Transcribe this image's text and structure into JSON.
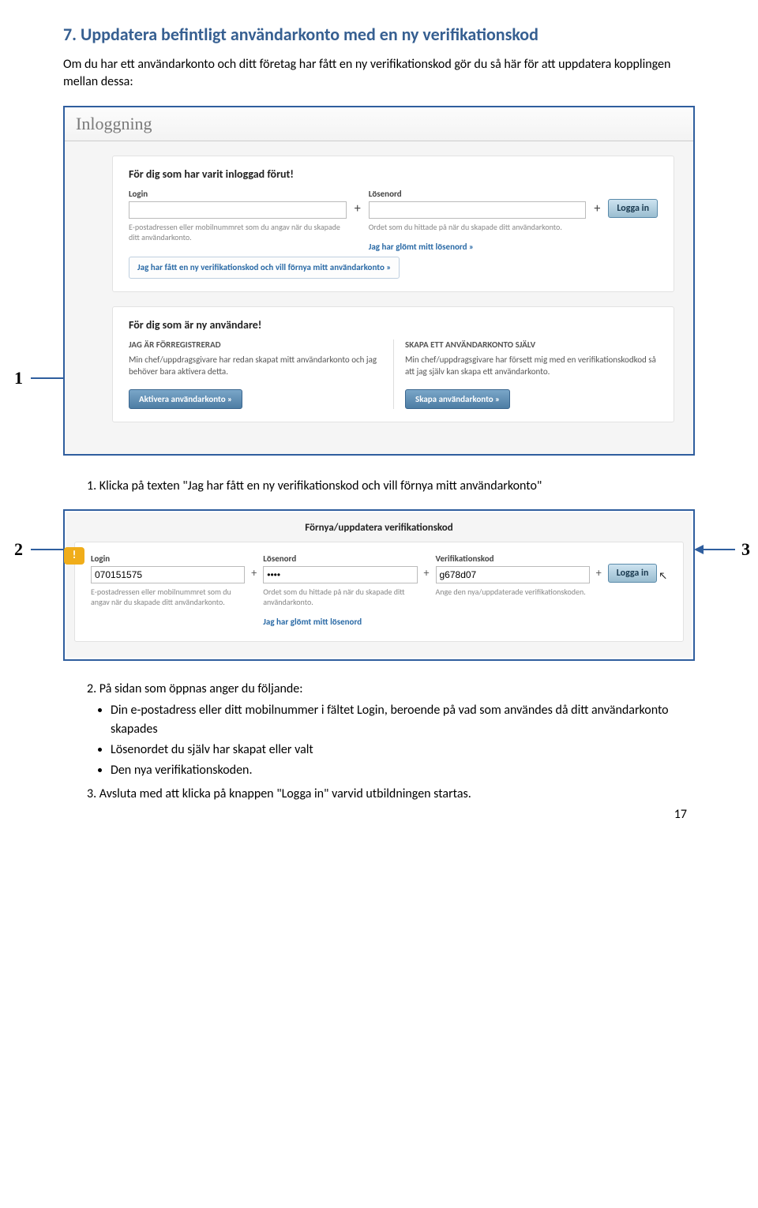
{
  "heading": "7. Uppdatera befintligt användarkonto med en ny verifikationskod",
  "intro": "Om du har ett användarkonto och ditt företag har fått en ny verifikationskod gör du så här för att uppdatera kopplingen mellan dessa:",
  "arrow1_num": "1",
  "arrow2_num": "2",
  "arrow3_num": "3",
  "ss1": {
    "tab": "Inloggning",
    "box1": {
      "title": "För dig som har varit inloggad förut!",
      "login_label": "Login",
      "login_help": "E-postadressen eller mobilnummret som du angav när du skapade ditt användarkonto.",
      "pass_label": "Lösenord",
      "pass_help": "Ordet som du hittade på när du skapade ditt användarkonto.",
      "login_btn": "Logga in",
      "forgot": "Jag har glömt mitt lösenord »",
      "verif_link": "Jag har fått en ny verifikationskod och vill förnya mitt användarkonto »"
    },
    "box2": {
      "title": "För dig som är ny användare!",
      "left_head": "JAG ÄR FÖRREGISTRERAD",
      "left_body": "Min chef/uppdragsgivare har redan skapat mitt användarkonto och jag behöver bara aktivera detta.",
      "left_btn": "Aktivera användarkonto »",
      "right_head": "SKAPA ETT ANVÄNDARKONTO SJÄLV",
      "right_body": "Min chef/uppdragsgivare har försett mig med en verifikationskodkod så att jag själv kan skapa ett användarkonto.",
      "right_btn": "Skapa användarkonto »"
    }
  },
  "step1": "1. Klicka på texten \"Jag har fått en ny verifikationskod och vill förnya mitt användarkonto\"",
  "ss2": {
    "title": "Förnya/uppdatera verifikationskod",
    "warn": "!",
    "login_label": "Login",
    "login_value": "070151575",
    "login_help": "E-postadressen eller mobilnummret som du angav när du skapade ditt användarkonto.",
    "pass_label": "Lösenord",
    "pass_value": "••••",
    "pass_help": "Ordet som du hittade på när du skapade ditt användarkonto.",
    "verif_label": "Verifikationskod",
    "verif_value": "g678d07",
    "verif_help": "Ange den nya/uppdaterade verifikationskoden.",
    "btn": "Logga in",
    "forgot": "Jag har glömt mitt lösenord"
  },
  "step2_intro": "2. På sidan som öppnas anger du följande:",
  "step2_b1": "Din e-postadress eller ditt mobilnummer i fältet Login, beroende på vad som användes då ditt användarkonto skapades",
  "step2_b2": "Lösenordet du själv har skapat eller valt",
  "step2_b3": "Den nya verifikationskoden.",
  "step3": "3. Avsluta med att klicka på knappen \"Logga in\" varvid utbildningen startas.",
  "page_num": "17"
}
